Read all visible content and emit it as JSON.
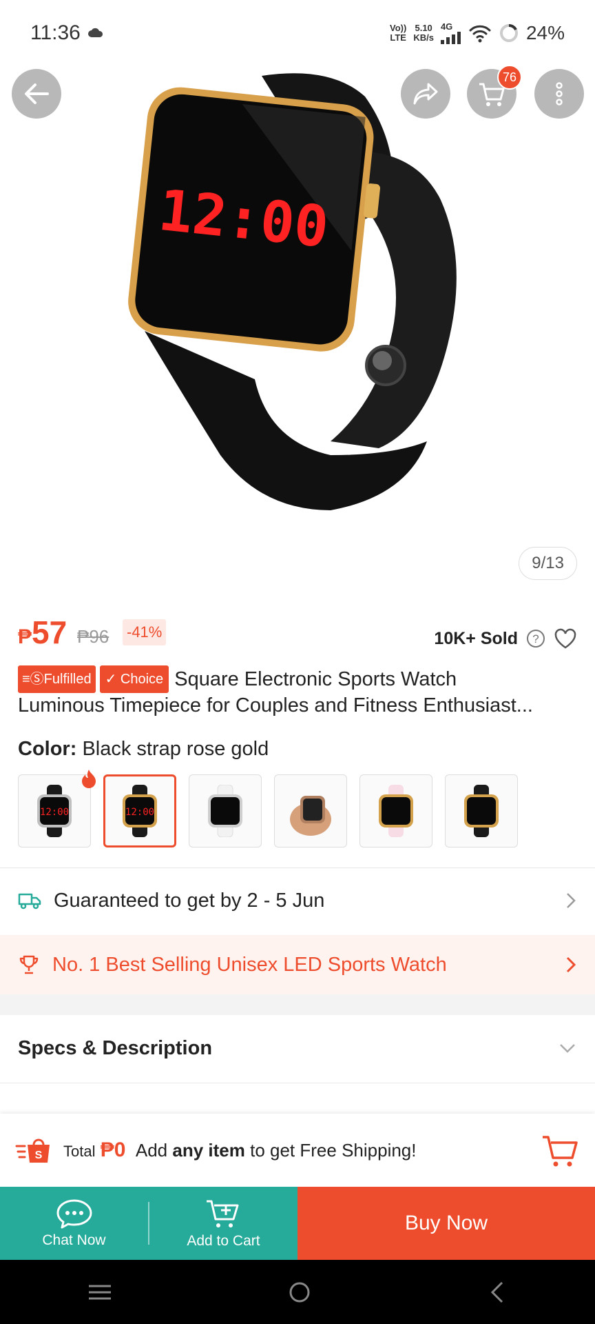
{
  "status_bar": {
    "time": "11:36",
    "volte_top": "Vo))",
    "volte_bottom": "LTE",
    "speed_top": "5.10",
    "speed_bottom": "KB/s",
    "network": "4G",
    "battery": "24%"
  },
  "gallery": {
    "counter": "9/13",
    "cart_count": "76",
    "watch_display": "12:00"
  },
  "price": {
    "currency": "₱",
    "current": "57",
    "original": "₱96",
    "discount": "-41%",
    "sold": "10K+ Sold"
  },
  "title": {
    "badge_fulfilled": "Fulfilled",
    "badge_choice": "✓ Choice",
    "line1": "Square Electronic Sports Watch",
    "line2": "Luminous Timepiece for Couples and Fitness Enthusiast..."
  },
  "color": {
    "label": "Color:",
    "value": "Black strap rose gold",
    "options": [
      {
        "strap": "#1a1a1a",
        "frame": "#c0c0c0"
      },
      {
        "strap": "#1a1a1a",
        "frame": "#d4a24c"
      },
      {
        "strap": "#f2f2f2",
        "frame": "#cfcfcf"
      },
      {
        "strap": "#d6a07a",
        "frame": "#b08060"
      },
      {
        "strap": "#f7dce6",
        "frame": "#d4a24c"
      },
      {
        "strap": "#1a1a1a",
        "frame": "#d4a24c"
      }
    ]
  },
  "delivery": {
    "text": "Guaranteed to get by 2 - 5 Jun"
  },
  "best_selling": {
    "text": "No. 1 Best Selling Unisex LED Sports Watch"
  },
  "specs": {
    "title": "Specs & Description"
  },
  "shipping_bar": {
    "total_label": "Total",
    "amount": "₱0",
    "prefix": "Add",
    "emphasis": "any item",
    "suffix": "to get Free Shipping!"
  },
  "actions": {
    "chat_label": "Chat Now",
    "add_cart_label": "Add to Cart",
    "buy_now_label": "Buy Now"
  },
  "colors": {
    "brand": "#ee4d2d",
    "teal": "#26aa99"
  }
}
